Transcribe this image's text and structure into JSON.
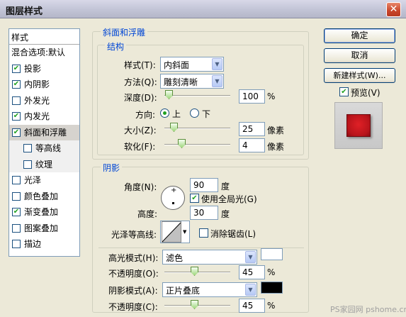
{
  "window": {
    "title": "图层样式",
    "close_icon": "close-icon"
  },
  "style_list": {
    "header": "样式",
    "blend_options": "混合选项:默认",
    "items": [
      {
        "label": "投影",
        "checked": true
      },
      {
        "label": "内阴影",
        "checked": true
      },
      {
        "label": "外发光",
        "checked": false
      },
      {
        "label": "内发光",
        "checked": true
      },
      {
        "label": "斜面和浮雕",
        "checked": true,
        "selected": true
      },
      {
        "label": "等高线",
        "checked": false,
        "sub": true
      },
      {
        "label": "纹理",
        "checked": false,
        "sub": true
      },
      {
        "label": "光泽",
        "checked": false
      },
      {
        "label": "颜色叠加",
        "checked": false
      },
      {
        "label": "渐变叠加",
        "checked": true
      },
      {
        "label": "图案叠加",
        "checked": false
      },
      {
        "label": "描边",
        "checked": false
      }
    ]
  },
  "bevel": {
    "section_title": "斜面和浮雕",
    "structure_title": "结构",
    "style_label": "样式(T):",
    "style_value": "内斜面",
    "technique_label": "方法(Q):",
    "technique_value": "雕刻清晰",
    "depth_label": "深度(D):",
    "depth_value": "100",
    "depth_unit": "%",
    "depth_level": 0.1,
    "direction_label": "方向:",
    "direction_up": "上",
    "direction_down": "下",
    "size_label": "大小(Z):",
    "size_value": "25",
    "size_unit": "像素",
    "size_level": 0.1,
    "soften_label": "软化(F):",
    "soften_value": "4",
    "soften_unit": "像素",
    "soften_level": 0.2
  },
  "shading": {
    "title": "阴影",
    "angle_label": "角度(N):",
    "angle_value": "90",
    "angle_unit": "度",
    "global_light_label": "使用全局光(G)",
    "altitude_label": "高度:",
    "altitude_value": "30",
    "altitude_unit": "度",
    "gloss_contour_label": "光泽等高线:",
    "antialias_label": "消除锯齿(L)",
    "highlight_mode_label": "高光模式(H):",
    "highlight_mode_value": "滤色",
    "highlight_color": "#ffffff",
    "highlight_opacity_label": "不透明度(O):",
    "highlight_opacity_value": "45",
    "highlight_opacity_unit": "%",
    "highlight_opacity_level": 0.45,
    "shadow_mode_label": "阴影模式(A):",
    "shadow_mode_value": "正片叠底",
    "shadow_color": "#000000",
    "shadow_opacity_label": "不透明度(C):",
    "shadow_opacity_value": "45",
    "shadow_opacity_unit": "%",
    "shadow_opacity_level": 0.45
  },
  "buttons": {
    "ok": "确定",
    "cancel": "取消",
    "new_style": "新建样式(W)...",
    "preview_label": "预览(V)"
  },
  "preview": {
    "swatch_color": "#c8141c"
  },
  "watermark": {
    "text": "PS家园网 pshome.cn"
  }
}
